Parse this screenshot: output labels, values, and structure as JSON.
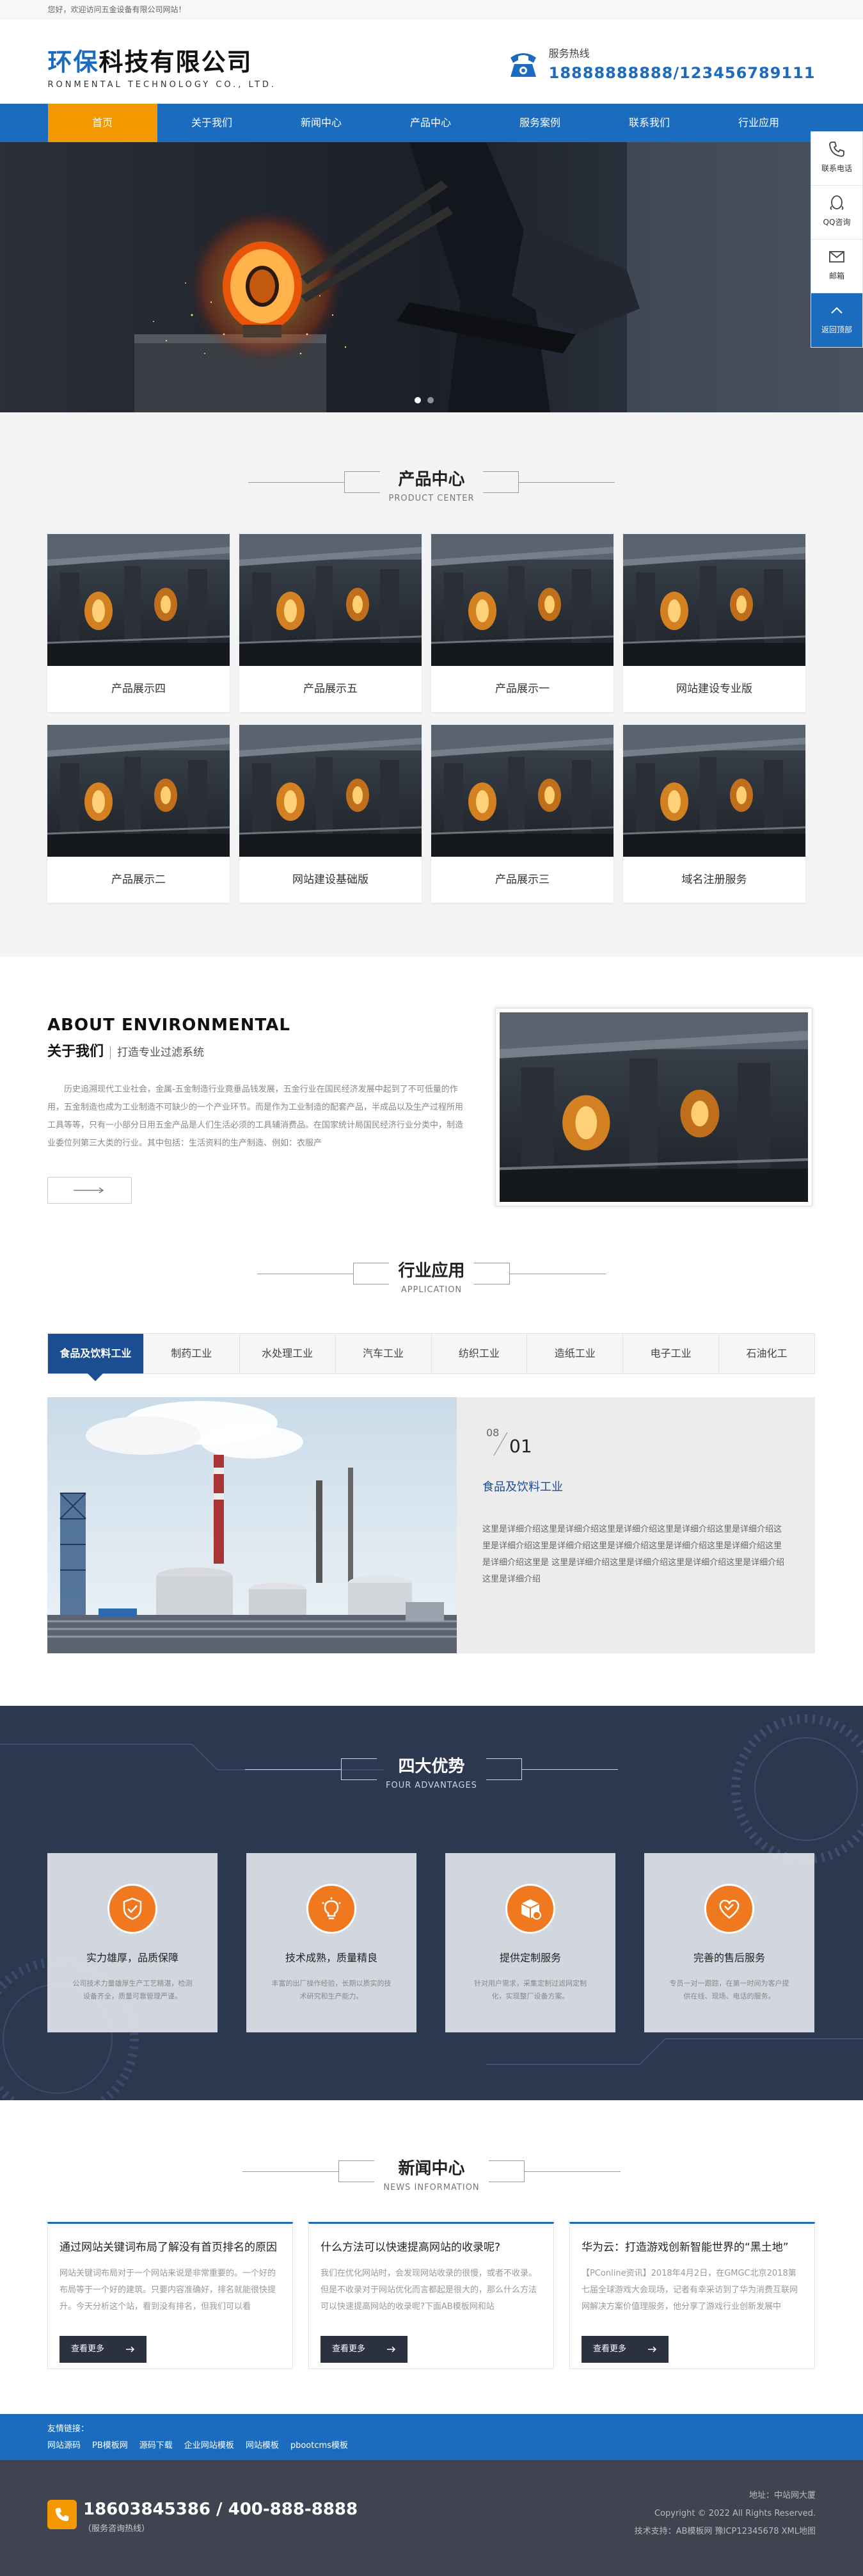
{
  "topbar": {
    "welcome": "您好，欢迎访问五金设备有限公司网站！"
  },
  "header": {
    "logo_cn_a": "环保",
    "logo_cn_b": "科技有限公司",
    "logo_en": "RONMENTAL TECHNOLOGY CO., LTD.",
    "hotline_label": "服务热线",
    "hotline_number": "18888888888/123456789111"
  },
  "nav": {
    "items": [
      "首页",
      "关于我们",
      "新闻中心",
      "产品中心",
      "服务案例",
      "联系我们",
      "行业应用"
    ],
    "active": 0
  },
  "float_bar": {
    "items": [
      "联系电话",
      "QQ咨询",
      "邮箱",
      "返回顶部"
    ]
  },
  "products": {
    "title": "产品中心",
    "subtitle": "PRODUCT CENTER",
    "items": [
      "产品展示四",
      "产品展示五",
      "产品展示一",
      "网站建设专业版",
      "产品展示二",
      "网站建设基础版",
      "产品展示三",
      "域名注册服务"
    ]
  },
  "about": {
    "title": "ABOUT ENVIRONMENTAL",
    "sub_main": "关于我们",
    "sub_tag": "打造专业过滤系统",
    "text": "历史追溯现代工业社会，金属-五金制造行业竟垂品钱发展，五金行业在国民经济发展中起到了不可低量的作用，五金制造也成为工业制造不可缺少的一个产业环节。而是作为工业制造的配套产品，半成品以及生产过程所用工具等等，只有一小部分日用五金产品是人们生活必须的工具辅消费品。在国家统计局国民经济行业分类中，制造业委位列第三大类的行业。其中包括：生活资料的生产制造、例如：衣服产"
  },
  "apps": {
    "title": "行业应用",
    "subtitle": "APPLICATION",
    "tabs": [
      "食品及饮料工业",
      "制药工业",
      "水处理工业",
      "汽车工业",
      "纺织工业",
      "造纸工业",
      "电子工业",
      "石油化工"
    ],
    "active": 0,
    "num_small": "08",
    "num_big": "01",
    "name": "食品及饮料工业",
    "desc": "这里是详细介绍这里是详细介绍这里是详细介绍这里是详细介绍这里是详细介绍这里是详细介绍这里是详细介绍这里是详细介绍这里是详细介绍这里是详细介绍这里是详细介绍这里是 这里是详细介绍这里是详细介绍这里是详细介绍这里是详细介绍这里是详细介绍"
  },
  "advantages": {
    "title": "四大优势",
    "subtitle": "FOUR ADVANTAGES",
    "items": [
      {
        "title": "实力雄厚，品质保障",
        "text": "公司技术力量雄厚生产工艺精湛，检测设备齐全，质量可靠管理严谨。",
        "icon": "shield-check-icon"
      },
      {
        "title": "技术成熟，质量精良",
        "text": "丰富的出厂操作经验，长期以质实的技术研究和生产能力。",
        "icon": "bulb-icon"
      },
      {
        "title": "提供定制服务",
        "text": "针对用户需求，采集定制过滤网定制化，实现整厂设备方案。",
        "icon": "box-icon"
      },
      {
        "title": "完善的售后服务",
        "text": "专员一对一跟踪，在第一时间为客户提供在线、现场、电话的服务。",
        "icon": "heart-icon"
      }
    ]
  },
  "news": {
    "title": "新闻中心",
    "subtitle": "NEWS INFORMATION",
    "items": [
      {
        "title": "通过网站关键词布局了解没有首页排名的原因",
        "text": "网站关键词布局对于一个网站来说是非常重要的。一个好的布局等于一个好的建筑。只要内容准确好，排名就能很快提升。今天分析这个站，看到没有排名，但我们可以看",
        "more": "查看更多"
      },
      {
        "title": "什么方法可以快速提高网站的收录呢?",
        "text": "我们在优化网站时，会发现网站收录的很慢，或者不收录。但是不收录对于网站优化而言都起是很大的，那么什么方法可以快速提高网站的收录呢?下面AB模板网和站",
        "more": "查看更多"
      },
      {
        "title": "华为云：打造游戏创新智能世界的“黑土地”",
        "text": "【PConline资讯】2018年4月2日，在GMGC北京2018第七届全球游戏大会现场，记者有幸采访到了华为消费互联网网解决方案价值理服务，他分享了游戏行业创新发展中",
        "more": "查看更多"
      }
    ]
  },
  "links": {
    "title": "友情链接：",
    "items": [
      "网站源码",
      "PB模板网",
      "源码下载",
      "企业网站模板",
      "网站模板",
      "pbootcms模板"
    ]
  },
  "footer": {
    "phone": "18603845386 / 400-888-8888",
    "phone_sub": "（服务咨询热线）",
    "address": "地址：中站网大厦",
    "copyright": "Copyright © 2022 All Rights Reserved.",
    "support": "技术支持：AB模板网  豫ICP12345678  XML地图"
  },
  "colors": {
    "brand": "#1b6bbe",
    "accent": "#f39800",
    "adv_icon": "#f0781e",
    "dark_tab": "#1b4d92"
  }
}
